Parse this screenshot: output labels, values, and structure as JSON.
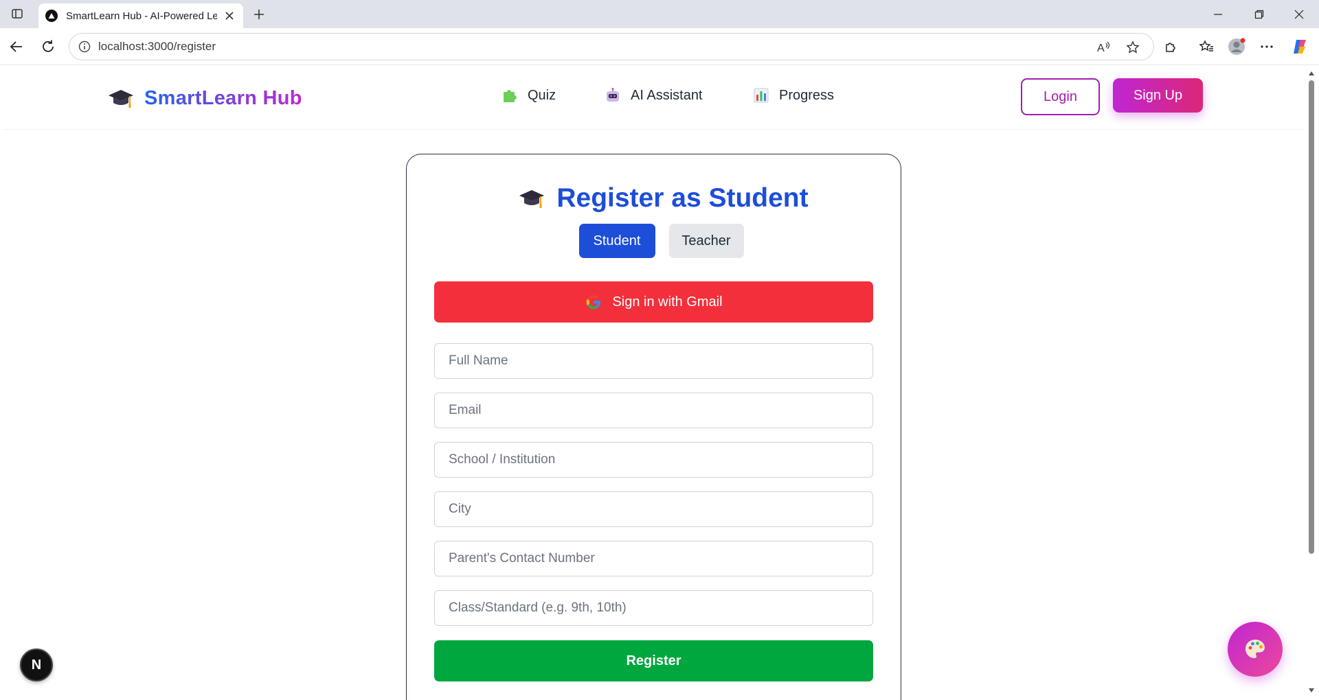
{
  "browser": {
    "tab_title": "SmartLearn Hub - AI-Powered Lea",
    "url": "localhost:3000/register",
    "icons": [
      "sidebar-toggle-icon",
      "tab-favicon-icon",
      "close-icon",
      "plus-icon",
      "back-icon",
      "reload-icon",
      "info-icon",
      "read-aloud-icon",
      "favorite-star-icon",
      "extensions-icon",
      "favorites-icon",
      "profile-icon",
      "more-icon",
      "copilot-icon",
      "minimize-icon",
      "restore-icon",
      "window-close-icon"
    ]
  },
  "navbar": {
    "brand": "SmartLearn Hub",
    "links": [
      {
        "label": "Quiz",
        "icon": "puzzle-icon"
      },
      {
        "label": "AI Assistant",
        "icon": "robot-icon"
      },
      {
        "label": "Progress",
        "icon": "bar-chart-icon"
      }
    ],
    "login_label": "Login",
    "signup_label": "Sign Up"
  },
  "form": {
    "title": "Register as Student",
    "roles": [
      "Student",
      "Teacher"
    ],
    "active_role": "Student",
    "gmail_label": "Sign in with Gmail",
    "fields": [
      {
        "placeholder": "Full Name",
        "value": ""
      },
      {
        "placeholder": "Email",
        "value": ""
      },
      {
        "placeholder": "School / Institution",
        "value": ""
      },
      {
        "placeholder": "City",
        "value": ""
      },
      {
        "placeholder": "Parent's Contact Number",
        "value": ""
      },
      {
        "placeholder": "Class/Standard (e.g. 9th, 10th)",
        "value": ""
      }
    ],
    "submit_label": "Register"
  },
  "floating": {
    "dev_badge": "N",
    "theme_button_icon": "palette-icon"
  },
  "colors": {
    "primary_blue": "#1d4ed8",
    "gmail_red": "#f22f3b",
    "register_green": "#00a63e",
    "accent_magenta": "#c026d3"
  }
}
